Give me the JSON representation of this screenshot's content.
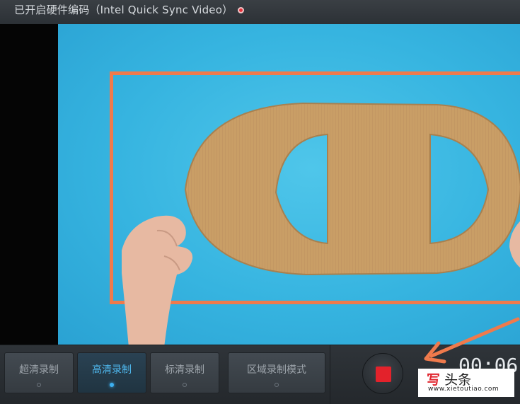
{
  "topbar": {
    "status_text": "已开启硬件编码（Intel Quick Sync Video）"
  },
  "modes": [
    {
      "label": "超清录制",
      "active": false
    },
    {
      "label": "高清录制",
      "active": true
    },
    {
      "label": "标清录制",
      "active": false
    },
    {
      "label": "区域录制模式",
      "active": false
    }
  ],
  "recorder": {
    "stop_icon": "stop-square-icon",
    "timer": "00:06"
  },
  "watermark": {
    "brand_logo_char": "写",
    "brand_text": "头条",
    "url": "www.xietoutiao.com"
  },
  "colors": {
    "accent_active": "#4fb8ee",
    "frame": "#ef7a4c",
    "stop": "#e3222b",
    "preview_bg": "#36b4e0"
  }
}
